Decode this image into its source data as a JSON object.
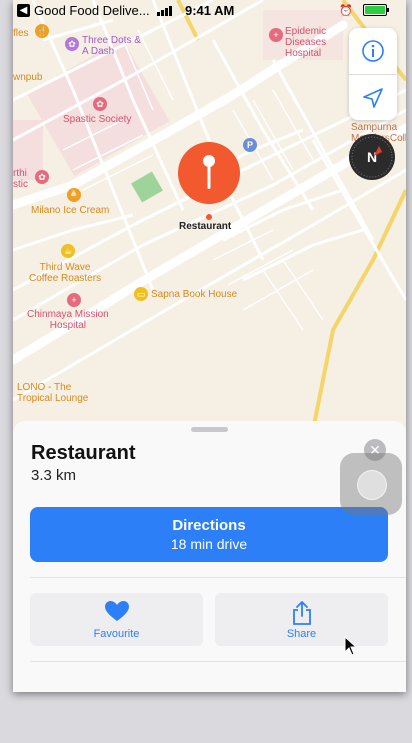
{
  "status_bar": {
    "back_app": "Good Food Delive...",
    "time": "9:41 AM",
    "alarm_icon": "alarm-icon",
    "battery_icon": "battery-icon"
  },
  "map": {
    "labels": {
      "waffles": "fles",
      "three_dots": "Three Dots &\nA Dash",
      "epidemic": "Epidemic\nDiseases\nHospital",
      "kanpub": "wnpub",
      "spastic": "Spastic Society",
      "sampurna": "Sampurna\nMontforsCollege",
      "arthi": "rthi\nstic",
      "milano": "Milano Ice Cream",
      "third_wave": "Third Wave\nCoffee Roasters",
      "sapna": "Sapna Book House",
      "chinmaya": "Chinmaya Mission\nHospital",
      "lono": "LONO - The\nTropical Lounge",
      "restaurant_pin": "Restaurant",
      "parking": "P"
    },
    "controls": {
      "info_icon": "info-icon",
      "location_icon": "location-arrow-icon",
      "compass_icon": "compass-icon"
    }
  },
  "place_card": {
    "title": "Restaurant",
    "distance": "3.3 km",
    "close_icon": "close-icon",
    "directions": {
      "label": "Directions",
      "sublabel": "18 min drive"
    },
    "actions": [
      {
        "label": "Favourite",
        "icon": "heart-icon"
      },
      {
        "label": "Share",
        "icon": "share-icon"
      }
    ]
  },
  "colors": {
    "accent": "#2c7ff6",
    "pin": "#f2592f",
    "map_background": "#f5efe4"
  }
}
